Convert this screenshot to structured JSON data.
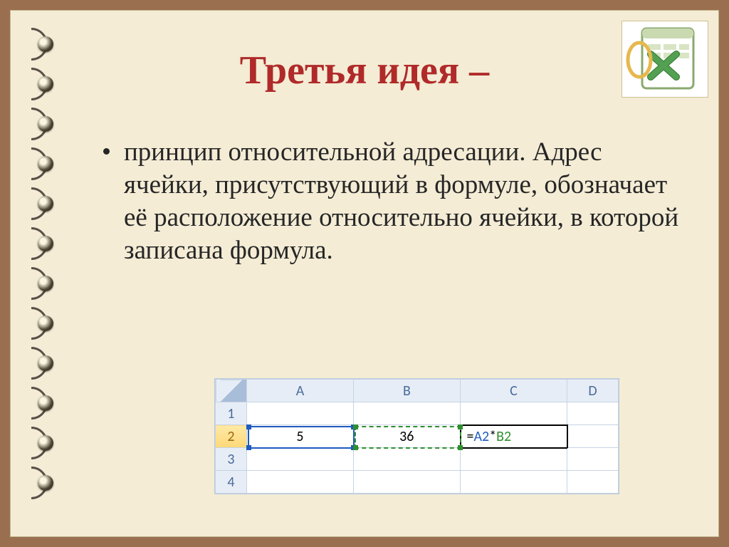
{
  "title": "Третья идея –",
  "bullet": "принцип относительной адресации. Адрес ячейки, присутствующий в формуле, обозначает её расположение относительно ячейки, в которой записана формула.",
  "grid": {
    "columns": [
      "A",
      "B",
      "C",
      "D"
    ],
    "rows": [
      "1",
      "2",
      "3",
      "4"
    ],
    "activeRow": 1,
    "values": {
      "A2": "5",
      "B2": "36"
    },
    "formula": {
      "cell": "C2",
      "prefix": "=",
      "refA": "A2",
      "op": "*",
      "refB": "B2"
    }
  },
  "excelIcon": "excel-logo"
}
